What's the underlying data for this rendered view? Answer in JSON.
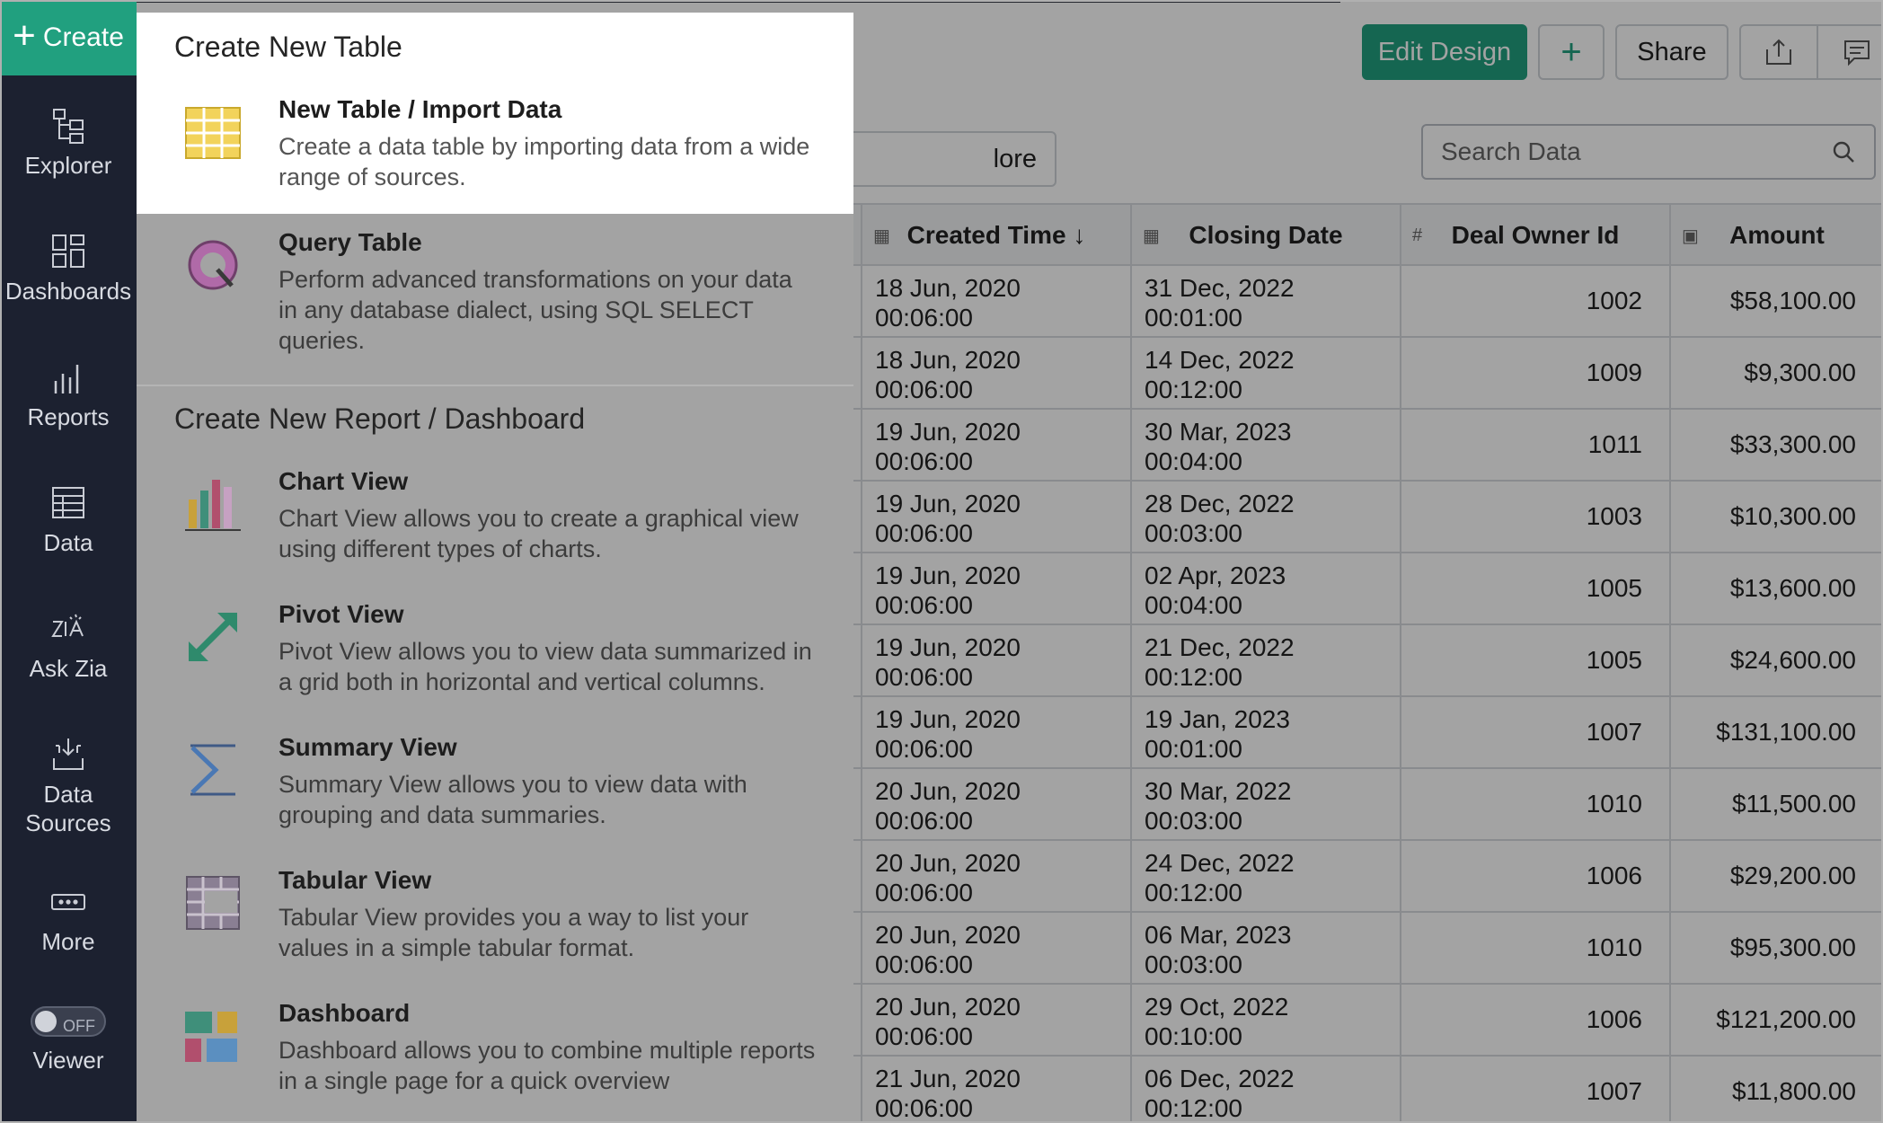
{
  "sidebar": {
    "create_label": "Create",
    "items": [
      {
        "label": "Explorer",
        "icon": "explorer-icon"
      },
      {
        "label": "Dashboards",
        "icon": "dashboards-icon"
      },
      {
        "label": "Reports",
        "icon": "reports-icon"
      },
      {
        "label": "Data",
        "icon": "data-icon"
      },
      {
        "label": "Ask Zia",
        "icon": "ask-zia-icon"
      },
      {
        "label": "Data",
        "label2": "Sources",
        "icon": "data-sources-icon"
      },
      {
        "label": "More",
        "icon": "more-icon"
      }
    ],
    "viewer": {
      "toggle_text": "OFF",
      "label": "Viewer"
    }
  },
  "toolbar": {
    "edit_design": "Edit Design",
    "add": "+",
    "share": "Share",
    "more_partial": "lore"
  },
  "search": {
    "placeholder": "Search Data"
  },
  "table": {
    "columns": [
      {
        "label": "Created Time",
        "sort": "↓",
        "icon": "calendar-icon"
      },
      {
        "label": "Closing Date",
        "icon": "calendar-icon"
      },
      {
        "label": "Deal Owner Id",
        "icon": "hash-icon"
      },
      {
        "label": "Amount",
        "icon": "currency-icon"
      }
    ],
    "rows": [
      {
        "created": [
          "18 Jun, 2020",
          "00:06:00"
        ],
        "closing": [
          "31 Dec, 2022",
          "00:01:00"
        ],
        "owner": "1002",
        "amount": "$58,100.00"
      },
      {
        "created": [
          "18 Jun, 2020",
          "00:06:00"
        ],
        "closing": [
          "14 Dec, 2022",
          "00:12:00"
        ],
        "owner": "1009",
        "amount": "$9,300.00"
      },
      {
        "created": [
          "19 Jun, 2020",
          "00:06:00"
        ],
        "closing": [
          "30 Mar, 2023",
          "00:04:00"
        ],
        "owner": "1011",
        "amount": "$33,300.00"
      },
      {
        "created": [
          "19 Jun, 2020",
          "00:06:00"
        ],
        "closing": [
          "28 Dec, 2022",
          "00:03:00"
        ],
        "owner": "1003",
        "amount": "$10,300.00"
      },
      {
        "created": [
          "19 Jun, 2020",
          "00:06:00"
        ],
        "closing": [
          "02 Apr, 2023",
          "00:04:00"
        ],
        "owner": "1005",
        "amount": "$13,600.00"
      },
      {
        "created": [
          "19 Jun, 2020",
          "00:06:00"
        ],
        "closing": [
          "21 Dec, 2022",
          "00:12:00"
        ],
        "owner": "1005",
        "amount": "$24,600.00"
      },
      {
        "created": [
          "19 Jun, 2020",
          "00:06:00"
        ],
        "closing": [
          "19 Jan, 2023",
          "00:01:00"
        ],
        "owner": "1007",
        "amount": "$131,100.00"
      },
      {
        "created": [
          "20 Jun, 2020",
          "00:06:00"
        ],
        "closing": [
          "30 Mar, 2022",
          "00:03:00"
        ],
        "owner": "1010",
        "amount": "$11,500.00"
      },
      {
        "created": [
          "20 Jun, 2020",
          "00:06:00"
        ],
        "closing": [
          "24 Dec, 2022",
          "00:12:00"
        ],
        "owner": "1006",
        "amount": "$29,200.00"
      },
      {
        "created": [
          "20 Jun, 2020",
          "00:06:00"
        ],
        "closing": [
          "06 Mar, 2023",
          "00:03:00"
        ],
        "owner": "1010",
        "amount": "$95,300.00"
      },
      {
        "created": [
          "20 Jun, 2020",
          "00:06:00"
        ],
        "closing": [
          "29 Oct, 2022",
          "00:10:00"
        ],
        "owner": "1006",
        "amount": "$121,200.00"
      },
      {
        "created": [
          "21 Jun, 2020",
          "00:06:00"
        ],
        "closing": [
          "06 Dec, 2022",
          "00:12:00"
        ],
        "owner": "1007",
        "amount": "$11,800.00"
      }
    ]
  },
  "create_menu": {
    "section1_title": "Create New Table",
    "section1_options": [
      {
        "title": "New Table / Import Data",
        "desc": "Create a data table by importing data from a wide range of sources.",
        "icon": "table-grid-icon"
      },
      {
        "title": "Query Table",
        "desc": "Perform advanced transformations on your data in any database dialect, using SQL SELECT queries.",
        "icon": "query-icon"
      }
    ],
    "section2_title": "Create New Report / Dashboard",
    "section2_options": [
      {
        "title": "Chart View",
        "desc": "Chart View allows you to create a graphical view using different types of charts.",
        "icon": "bar-chart-icon"
      },
      {
        "title": "Pivot View",
        "desc": "Pivot View allows you to view data summarized in a grid both in horizontal and vertical columns.",
        "icon": "pivot-arrows-icon"
      },
      {
        "title": "Summary View",
        "desc": "Summary View allows you to view data with grouping and data summaries.",
        "icon": "sigma-icon"
      },
      {
        "title": "Tabular View",
        "desc": "Tabular View provides you a way to list your values in a simple tabular format.",
        "icon": "tabular-icon"
      },
      {
        "title": "Dashboard",
        "desc": "Dashboard allows you to combine multiple reports in a single page for a quick overview",
        "icon": "dashboard-tiles-icon"
      }
    ]
  },
  "colors": {
    "accent": "#21a07f",
    "sidebar_bg": "#1c2130"
  }
}
